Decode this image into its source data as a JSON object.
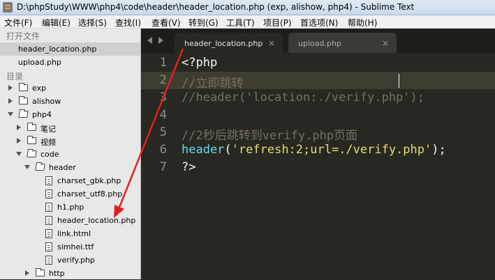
{
  "window": {
    "title": "D:\\phpStudy\\WWW\\php4\\code\\header\\header_location.php (exp, alishow, php4) - Sublime Text"
  },
  "menu": [
    "文件(F)",
    "编辑(E)",
    "选择(S)",
    "查找(I)",
    "查看(V)",
    "转到(G)",
    "工具(T)",
    "项目(P)",
    "首选项(N)",
    "帮助(H)"
  ],
  "sidebar": {
    "open_files_heading": "打开文件",
    "open_files": [
      "header_location.php",
      "upload.php"
    ],
    "folders_heading": "目录",
    "tree": [
      {
        "label": "exp",
        "kind": "folder",
        "state": "collapsed"
      },
      {
        "label": "alishow",
        "kind": "folder",
        "state": "collapsed"
      },
      {
        "label": "php4",
        "kind": "folder",
        "state": "expanded"
      },
      {
        "label": "笔记",
        "kind": "folder",
        "state": "collapsed"
      },
      {
        "label": "视频",
        "kind": "folder",
        "state": "collapsed"
      },
      {
        "label": "code",
        "kind": "folder",
        "state": "expanded"
      },
      {
        "label": "header",
        "kind": "folder",
        "state": "expanded"
      },
      {
        "label": "charset_gbk.php",
        "kind": "file"
      },
      {
        "label": "charset_utf8.php",
        "kind": "file"
      },
      {
        "label": "h1.php",
        "kind": "file"
      },
      {
        "label": "header_location.php",
        "kind": "file"
      },
      {
        "label": "link.html",
        "kind": "file"
      },
      {
        "label": "simhei.ttf",
        "kind": "file"
      },
      {
        "label": "verify.php",
        "kind": "file"
      },
      {
        "label": "http",
        "kind": "folder",
        "state": "collapsed"
      }
    ]
  },
  "tabs": [
    {
      "label": "header_location.php",
      "active": true,
      "close": "×"
    },
    {
      "label": "upload.php",
      "active": false,
      "close": "×"
    }
  ],
  "editor": {
    "current_line": 2,
    "lines": [
      {
        "n": "1",
        "tokens": [
          {
            "t": "<?php",
            "c": "#f8f8f2"
          }
        ]
      },
      {
        "n": "2",
        "tokens": [
          {
            "t": "//立即跳转",
            "c": "#75715e"
          }
        ]
      },
      {
        "n": "3",
        "tokens": [
          {
            "t": "//header('location:./verify.php');",
            "c": "#75715e"
          }
        ]
      },
      {
        "n": "4",
        "tokens": []
      },
      {
        "n": "5",
        "tokens": [
          {
            "t": "//2秒后跳转到verify.php页面",
            "c": "#75715e"
          }
        ]
      },
      {
        "n": "6",
        "tokens": [
          {
            "t": "header",
            "c": "#66d9ef"
          },
          {
            "t": "(",
            "c": "#f8f8f2"
          },
          {
            "t": "'refresh:2;url=./verify.php'",
            "c": "#e6db74"
          },
          {
            "t": ");",
            "c": "#f8f8f2"
          }
        ]
      },
      {
        "n": "7",
        "tokens": [
          {
            "t": "?>",
            "c": "#f8f8f2"
          }
        ]
      }
    ]
  },
  "colors": {
    "editor_bg": "#272822",
    "annotation_arrow": "#e02020"
  }
}
